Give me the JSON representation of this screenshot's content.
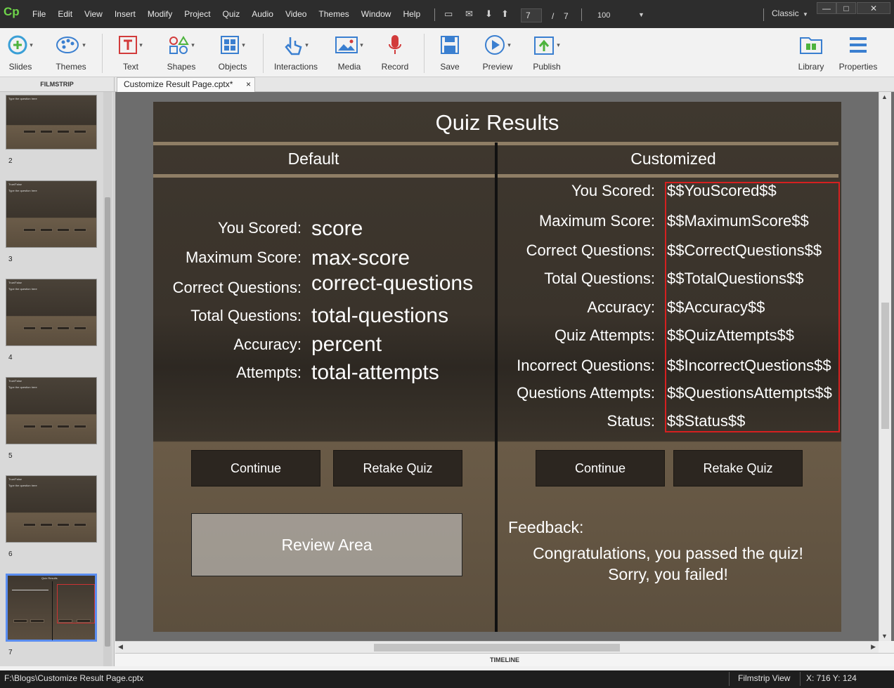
{
  "app": {
    "logo": "Cp",
    "menu": [
      "File",
      "Edit",
      "View",
      "Insert",
      "Modify",
      "Project",
      "Quiz",
      "Audio",
      "Video",
      "Themes",
      "Window",
      "Help"
    ],
    "slide_current": "7",
    "slide_sep": "/",
    "slide_total": "7",
    "zoom": "100",
    "mode": "Classic"
  },
  "toolbar": {
    "slides": "Slides",
    "themes": "Themes",
    "text": "Text",
    "shapes": "Shapes",
    "objects": "Objects",
    "interactions": "Interactions",
    "media": "Media",
    "record": "Record",
    "save": "Save",
    "preview": "Preview",
    "publish": "Publish",
    "library": "Library",
    "properties": "Properties"
  },
  "panels": {
    "filmstrip_title": "FILMSTRIP",
    "doc_tab": "Customize Result Page.cptx*",
    "doc_close": "×",
    "timeline": "TIMELINE"
  },
  "filmstrip": {
    "slides": [
      {
        "num": "2",
        "title": "True/False",
        "subtitle": "Type the question here"
      },
      {
        "num": "3",
        "title": "True/False",
        "subtitle": "Type the question here"
      },
      {
        "num": "4",
        "title": "True/False",
        "subtitle": "Type the question here"
      },
      {
        "num": "5",
        "title": "True/False",
        "subtitle": "Type the question here"
      },
      {
        "num": "6",
        "title": "True/False",
        "subtitle": "Type the question here"
      },
      {
        "num": "7",
        "title": "Quiz Results",
        "subtitle": ""
      }
    ]
  },
  "slide": {
    "title": "Quiz Results",
    "default_header": "Default",
    "custom_header": "Customized",
    "default_rows": [
      {
        "label": "You Scored:",
        "value": "score"
      },
      {
        "label": "Maximum Score:",
        "value": "max-score"
      },
      {
        "label": "Correct Questions:",
        "value": "correct-questions"
      },
      {
        "label": "Total Questions:",
        "value": "total-questions"
      },
      {
        "label": "Accuracy:",
        "value": "percent"
      },
      {
        "label": "Attempts:",
        "value": "total-attempts"
      }
    ],
    "custom_rows": [
      {
        "label": "You Scored:",
        "value": "$$YouScored$$"
      },
      {
        "label": "Maximum Score:",
        "value": "$$MaximumScore$$"
      },
      {
        "label": "Correct Questions:",
        "value": "$$CorrectQuestions$$"
      },
      {
        "label": "Total Questions:",
        "value": "$$TotalQuestions$$"
      },
      {
        "label": "Accuracy:",
        "value": "$$Accuracy$$"
      },
      {
        "label": "Quiz Attempts:",
        "value": "$$QuizAttempts$$"
      },
      {
        "label": "Incorrect Questions:",
        "value": "$$IncorrectQuestions$$"
      },
      {
        "label": "Questions Attempts:",
        "value": "$$QuestionsAttempts$$"
      },
      {
        "label": "Status:",
        "value": "$$Status$$"
      }
    ],
    "continue_label": "Continue",
    "retake_label": "Retake Quiz",
    "review_area": "Review Area",
    "feedback_label": "Feedback:",
    "pass_message": "Congratulations, you passed the quiz!",
    "fail_message": "Sorry, you failed!"
  },
  "status": {
    "path": "F:\\Blogs\\Customize Result Page.cptx",
    "view": "Filmstrip View",
    "coords": "X: 716 Y: 124"
  },
  "colors": {
    "highlight_box": "#d52020",
    "selected_thumb": "#5a8df0",
    "logo_green": "#6fd44a"
  }
}
